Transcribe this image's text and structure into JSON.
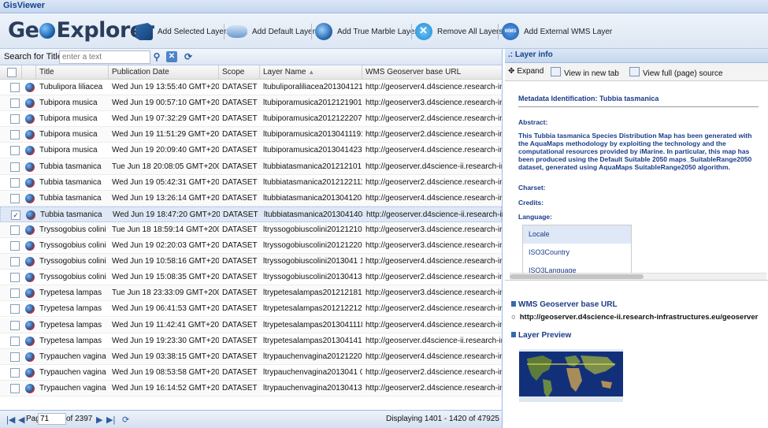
{
  "app": {
    "title": "GisViewer",
    "logo": "GeoExplorer"
  },
  "toolbar": {
    "add_selected": "Add Selected Layers",
    "add_default": "Add Default Layers",
    "add_marble": "Add True Marble Layer",
    "remove_all": "Remove All Layers",
    "add_wms": "Add External WMS Layer",
    "wms_badge": "WMS"
  },
  "search": {
    "label": "Search for Title",
    "placeholder": "enter a text"
  },
  "grid": {
    "columns": [
      "Title",
      "Publication Date",
      "Scope Code",
      "Layer Name",
      "WMS Geoserver base URL"
    ],
    "sort_indicator": "▲",
    "rows": [
      {
        "title": "Tubulipora liliacea",
        "date": "Wed Jun 19 13:55:40 GMT+200...",
        "scope": "DATASET",
        "layer": "ltubuliporaliliacea2013041213...",
        "url": "http://geoserver4.d4science.research-infr...",
        "checked": false
      },
      {
        "title": "Tubipora musica",
        "date": "Wed Jun 19 00:57:10 GMT+200...",
        "scope": "DATASET",
        "layer": "ltubiporamusica20121219013...",
        "url": "http://geoserver3.d4science.research-infr...",
        "checked": false
      },
      {
        "title": "Tubipora musica",
        "date": "Wed Jun 19 07:32:29 GMT+200...",
        "scope": "DATASET",
        "layer": "ltubiporamusica20121222070...",
        "url": "http://geoserver2.d4science.research-infr...",
        "checked": false
      },
      {
        "title": "Tubipora musica",
        "date": "Wed Jun 19 11:51:29 GMT+200...",
        "scope": "DATASET",
        "layer": "ltubiporamusica20130411191...",
        "url": "http://geoserver2.d4science.research-infr...",
        "checked": false
      },
      {
        "title": "Tubipora musica",
        "date": "Wed Jun 19 20:09:40 GMT+200...",
        "scope": "DATASET",
        "layer": "ltubiporamusica20130414230...",
        "url": "http://geoserver4.d4science.research-infr...",
        "checked": false
      },
      {
        "title": "Tubbia tasmanica",
        "date": "Tue Jun 18 20:08:05 GMT+200 ...",
        "scope": "DATASET",
        "layer": "ltubbiatasmanica201212101 8...",
        "url": "http://geoserver.d4science-ii.research-infr...",
        "checked": false
      },
      {
        "title": "Tubbia tasmanica",
        "date": "Wed Jun 19 05:42:31 GMT+200...",
        "scope": "DATASET",
        "layer": "ltubbiatasmanica2012122111...",
        "url": "http://geoserver2.d4science.research-infr...",
        "checked": false
      },
      {
        "title": "Tubbia tasmanica",
        "date": "Wed Jun 19 13:26:14 GMT+200...",
        "scope": "DATASET",
        "layer": "ltubbiatasmanica2013041208...",
        "url": "http://geoserver4.d4science.research-infr...",
        "checked": false
      },
      {
        "title": "Tubbia tasmanica",
        "date": "Wed Jun 19 18:47:20 GMT+200...",
        "scope": "DATASET",
        "layer": "ltubbiatasmanica2013041408...",
        "url": "http://geoserver.d4science-ii.research-infr...",
        "checked": true
      },
      {
        "title": "Tryssogobius colini",
        "date": "Tue Jun 18 18:59:14 GMT+200 ...",
        "scope": "DATASET",
        "layer": "ltryssogobiuscolini201212100...",
        "url": "http://geoserver3.d4science.research-infr...",
        "checked": false
      },
      {
        "title": "Tryssogobius colini",
        "date": "Wed Jun 19 02:20:03 GMT+200...",
        "scope": "DATASET",
        "layer": "ltryssogobiuscolini201212200...",
        "url": "http://geoserver3.d4science.research-infr...",
        "checked": false
      },
      {
        "title": "Tryssogobius colini",
        "date": "Wed Jun 19 10:58:16 GMT+200...",
        "scope": "DATASET",
        "layer": "ltryssogobiuscolini2013041 11...",
        "url": "http://geoserver4.d4science.research-infr...",
        "checked": false
      },
      {
        "title": "Tryssogobius colini",
        "date": "Wed Jun 19 15:08:35 GMT+200...",
        "scope": "DATASET",
        "layer": "ltryssogobiuscolini201304130...",
        "url": "http://geoserver2.d4science.research-infr...",
        "checked": false
      },
      {
        "title": "Trypetesa lampas",
        "date": "Tue Jun 18 23:33:09 GMT+200 ...",
        "scope": "DATASET",
        "layer": "ltrypetesalampas2012121818...",
        "url": "http://geoserver3.d4science.research-infr...",
        "checked": false
      },
      {
        "title": "Trypetesa lampas",
        "date": "Wed Jun 19 06:41:53 GMT+200...",
        "scope": "DATASET",
        "layer": "ltrypetesalampas2012122122...",
        "url": "http://geoserver2.d4science.research-infr...",
        "checked": false
      },
      {
        "title": "Trypetesa lampas",
        "date": "Wed Jun 19 11:42:41 GMT+200 ...",
        "scope": "DATASET",
        "layer": "ltrypetesalampas2013041118...",
        "url": "http://geoserver4.d4science.research-infr...",
        "checked": false
      },
      {
        "title": "Trypetesa lampas",
        "date": "Wed Jun 19 19:23:30 GMT+200...",
        "scope": "DATASET",
        "layer": "ltrypetesalampas2013041415...",
        "url": "http://geoserver.d4science-ii.research-infr...",
        "checked": false
      },
      {
        "title": "Trypauchen vagina",
        "date": "Wed Jun 19 03:38:15 GMT+200...",
        "scope": "DATASET",
        "layer": "ltrypauchenvagina201212201...",
        "url": "http://geoserver4.d4science.research-infr...",
        "checked": false
      },
      {
        "title": "Trypauchen vagina",
        "date": "Wed Jun 19 08:53:58 GMT+200...",
        "scope": "DATASET",
        "layer": "ltrypauchenvagina2013041 01...",
        "url": "http://geoserver2.d4science.research-infr...",
        "checked": false
      },
      {
        "title": "Trypauchen vagina",
        "date": "Wed Jun 19 16:14:52 GMT+200...",
        "scope": "DATASET",
        "layer": "ltrypauchenvagina201304131...",
        "url": "http://geoserver2.d4science.research-infr...",
        "checked": false
      }
    ]
  },
  "pager": {
    "page_label": "Page",
    "page": "71",
    "of": "of 2397",
    "display": "Displaying 1401 - 1420 of 47925"
  },
  "layer_info": {
    "header": ".: Layer info",
    "expand": "Expand",
    "view_tab": "View in new tab",
    "view_full": "View full (page) source",
    "meta_title": "Metadata Identification: Tubbia tasmanica",
    "abstract_label": "Abstract:",
    "abstract": "This Tubbia tasmanica Species Distribution Map has been generated with the AquaMaps methodology by exploiting the technology and the computational resources provided by iMarine. In particular, this map has been produced using the Default Suitable 2050 maps_SuitableRange2050 dataset, generated using AquaMaps SuitableRange2050 algorithm.",
    "charset_label": "Charset:",
    "credits_label": "Credits:",
    "language_label": "Language:",
    "locale": [
      "Locale",
      "ISO3Country",
      "ISO3Language"
    ],
    "wms_label": "WMS Geoserver base URL",
    "wms_url": "http://geoserver.d4science-ii.research-infrastructures.eu/geoserver",
    "preview_label": "Layer Preview"
  }
}
